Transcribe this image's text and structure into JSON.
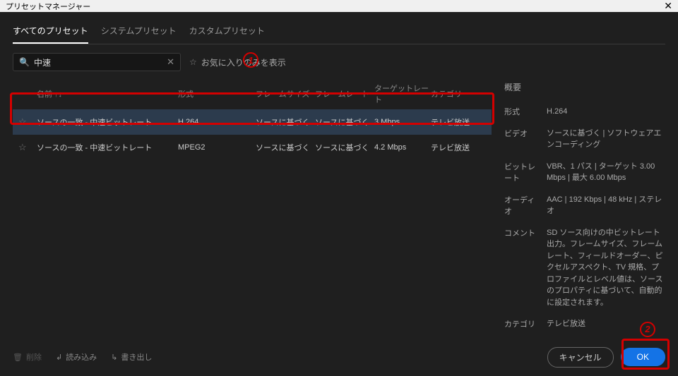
{
  "window": {
    "title": "プリセットマネージャー"
  },
  "tabs": {
    "items": [
      {
        "label": "すべてのプリセット",
        "active": true
      },
      {
        "label": "システムプリセット",
        "active": false
      },
      {
        "label": "カスタムプリセット",
        "active": false
      }
    ]
  },
  "search": {
    "value": "中速",
    "favorites_label": "お気に入りのみを表示"
  },
  "columns": {
    "name": "名前 ↑↓",
    "format": "形式",
    "framesize": "フレームサイズ",
    "framerate": "フレームレート",
    "targetrate": "ターゲットレート",
    "category": "カテゴリ"
  },
  "rows": [
    {
      "name": "ソースの一致 - 中速ビットレート",
      "format": "H.264",
      "framesize": "ソースに基づく",
      "framerate": "ソースに基づく",
      "targetrate": "3 Mbps",
      "category": "テレビ放送",
      "selected": true
    },
    {
      "name": "ソースの一致 - 中速ビットレート",
      "format": "MPEG2",
      "framesize": "ソースに基づく",
      "framerate": "ソースに基づく",
      "targetrate": "4.2 Mbps",
      "category": "テレビ放送",
      "selected": false
    }
  ],
  "summary": {
    "title": "概要",
    "format_label": "形式",
    "format_value": "H.264",
    "video_label": "ビデオ",
    "video_value": "ソースに基づく | ソフトウェアエンコーディング",
    "bitrate_label": "ビットレート",
    "bitrate_value": "VBR、1 パス | ターゲット 3.00 Mbps | 最大 6.00 Mbps",
    "audio_label": "オーディオ",
    "audio_value": "AAC | 192 Kbps | 48 kHz | ステレオ",
    "comment_label": "コメント",
    "comment_value": "SD ソース向けの中ビットレート出力。フレームサイズ、フレームレート、フィールドオーダー、ピクセルアスペクト、TV 規格、プロファイルとレベル値は、ソースのプロパティに基づいて、自動的に設定されます。",
    "category_label": "カテゴリ",
    "category_value": "テレビ放送"
  },
  "footer": {
    "delete_label": "削除",
    "import_label": "読み込み",
    "export_label": "書き出し",
    "cancel_label": "キャンセル",
    "ok_label": "OK"
  },
  "annotations": {
    "num1": "1",
    "num2": "2"
  }
}
